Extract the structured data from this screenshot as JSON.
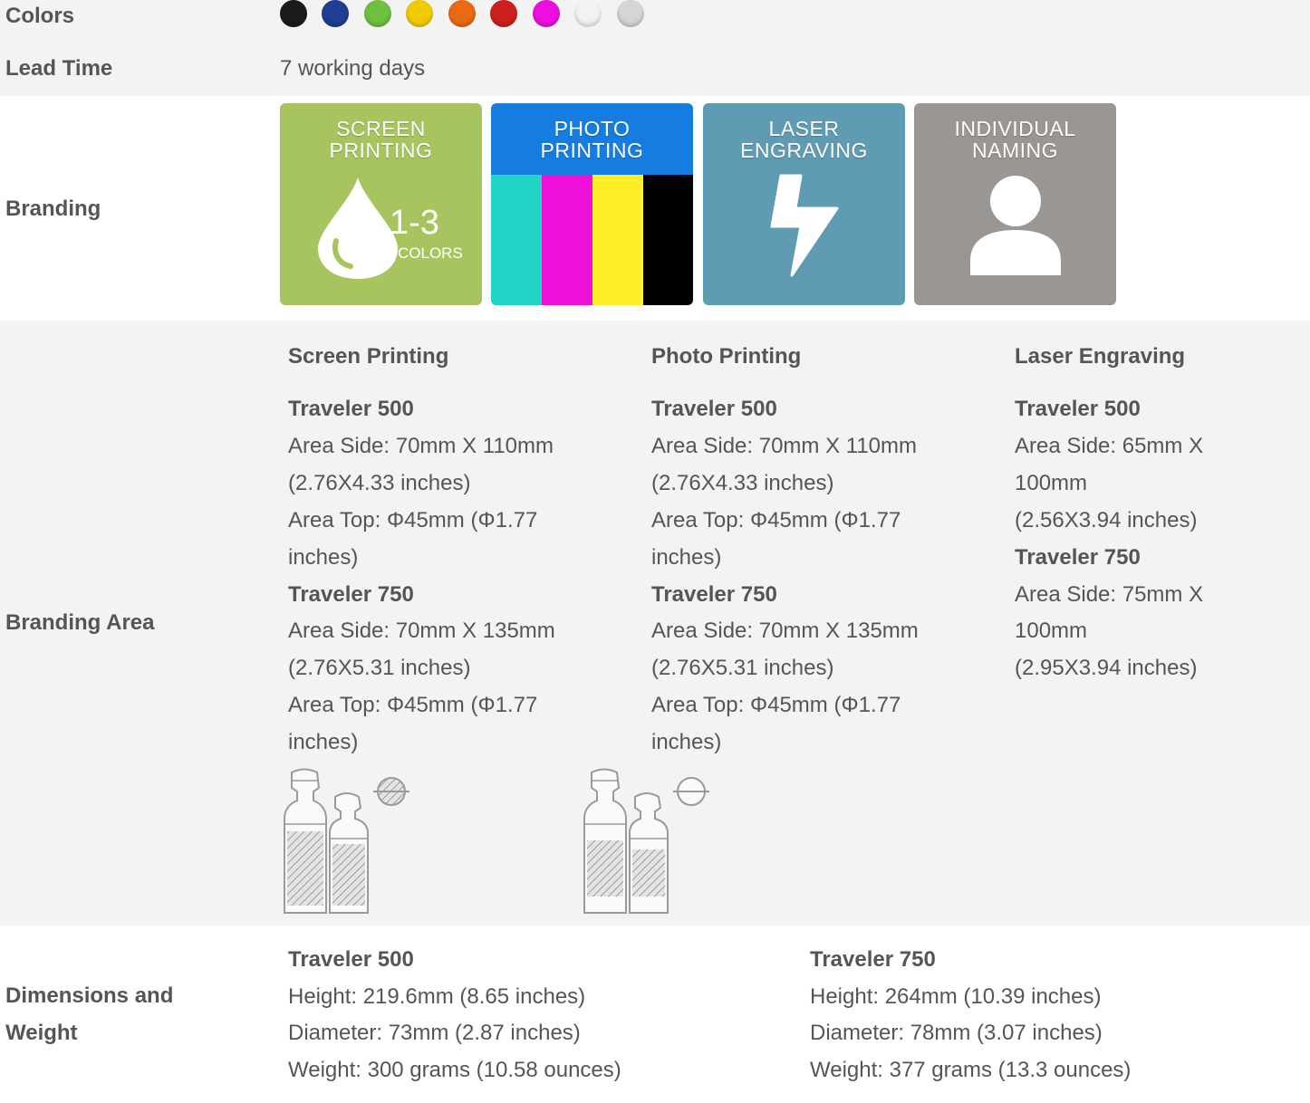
{
  "rows": {
    "colors": {
      "label": "Colors",
      "swatches": [
        {
          "name": "black",
          "hex": "#1b1b1b"
        },
        {
          "name": "navy",
          "hex": "#1f3e94"
        },
        {
          "name": "green",
          "hex": "#6ec13f"
        },
        {
          "name": "yellow",
          "hex": "#f1cb00"
        },
        {
          "name": "orange",
          "hex": "#ea6a13"
        },
        {
          "name": "red",
          "hex": "#cf1e1e"
        },
        {
          "name": "magenta",
          "hex": "#ec0fe0"
        },
        {
          "name": "white",
          "hex": "#f2f2f2"
        },
        {
          "name": "grey",
          "hex": "#d5d5d5"
        }
      ]
    },
    "lead_time": {
      "label": "Lead Time",
      "value": "7 working days"
    },
    "branding": {
      "label": "Branding",
      "tiles": [
        {
          "line1": "SCREEN",
          "line2": "PRINTING",
          "badge": "1-3",
          "badge_sub": "COLORS",
          "color": "#a8c45f"
        },
        {
          "line1": "PHOTO",
          "line2": "PRINTING",
          "color": "#157de0",
          "stripes": [
            "#22d3c7",
            "#ee0fd9",
            "#ffef2b",
            "#000000"
          ]
        },
        {
          "line1": "LASER",
          "line2": "ENGRAVING",
          "color": "#5f9cb4"
        },
        {
          "line1": "INDIVIDUAL",
          "line2": "NAMING",
          "color": "#9a9694"
        }
      ]
    },
    "branding_area": {
      "label": "Branding Area",
      "columns": [
        {
          "heading": "Screen Printing",
          "lines": [
            {
              "text": "Traveler 500",
              "bold": true
            },
            {
              "text": "Area Side: 70mm X 110mm"
            },
            {
              "text": "(2.76X4.33 inches)"
            },
            {
              "text": "Area Top: Φ45mm (Φ1.77"
            },
            {
              "text": "inches)"
            },
            {
              "text": "Traveler 750",
              "bold": true
            },
            {
              "text": "Area Side: 70mm X 135mm"
            },
            {
              "text": "(2.76X5.31 inches)"
            },
            {
              "text": "Area Top: Φ45mm (Φ1.77"
            },
            {
              "text": "inches)"
            }
          ]
        },
        {
          "heading": "Photo Printing",
          "lines": [
            {
              "text": "Traveler 500",
              "bold": true
            },
            {
              "text": "Area Side: 70mm X 110mm"
            },
            {
              "text": "(2.76X4.33 inches)"
            },
            {
              "text": "Area Top: Φ45mm (Φ1.77"
            },
            {
              "text": "inches)"
            },
            {
              "text": "Traveler 750",
              "bold": true
            },
            {
              "text": "Area Side: 70mm X 135mm"
            },
            {
              "text": "(2.76X5.31 inches)"
            },
            {
              "text": "Area Top: Φ45mm (Φ1.77"
            },
            {
              "text": "inches)"
            }
          ]
        },
        {
          "heading": "Laser Engraving",
          "lines": [
            {
              "text": "Traveler 500",
              "bold": true
            },
            {
              "text": "Area Side: 65mm X"
            },
            {
              "text": "100mm"
            },
            {
              "text": "(2.56X3.94 inches)"
            },
            {
              "text": "Traveler 750",
              "bold": true
            },
            {
              "text": "Area Side: 75mm X"
            },
            {
              "text": "100mm"
            },
            {
              "text": "(2.95X3.94 inches)"
            }
          ]
        }
      ]
    },
    "dimensions": {
      "label_line1": "Dimensions and",
      "label_line2": "Weight",
      "columns": [
        {
          "title": "Traveler 500",
          "height": "Height: 219.6mm (8.65 inches)",
          "diameter": "Diameter: 73mm (2.87 inches)",
          "weight": "Weight: 300 grams (10.58 ounces)"
        },
        {
          "title": "Traveler 750",
          "height": "Height: 264mm (10.39 inches)",
          "diameter": "Diameter: 78mm (3.07 inches)",
          "weight": "Weight: 377 grams (13.3 ounces)"
        }
      ]
    }
  }
}
